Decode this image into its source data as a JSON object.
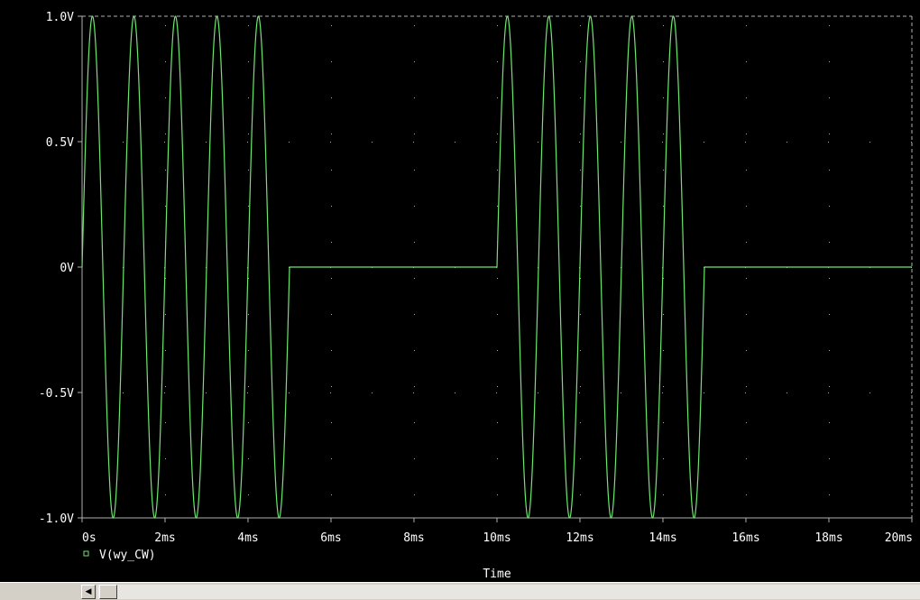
{
  "colors": {
    "background": "#000000",
    "trace": "#6ee66e",
    "grid": "#b0b0b0",
    "text": "#ffffff"
  },
  "chart_data": {
    "type": "line",
    "xlabel": "Time",
    "ylabel": "",
    "xlim": [
      0,
      20
    ],
    "ylim": [
      -1.0,
      1.0
    ],
    "x_unit": "ms",
    "x_ticks": [
      0,
      2,
      4,
      6,
      8,
      10,
      12,
      14,
      16,
      18,
      20
    ],
    "x_tick_labels": [
      "0s",
      "2ms",
      "4ms",
      "6ms",
      "8ms",
      "10ms",
      "12ms",
      "14ms",
      "16ms",
      "18ms",
      "20ms"
    ],
    "y_ticks": [
      1.0,
      0.5,
      0,
      -0.5,
      -1.0
    ],
    "y_tick_labels": [
      "1.0V",
      "0.5V",
      "0V",
      "-0.5V",
      "-1.0V"
    ],
    "grid": true,
    "legend_position": "bottom-left",
    "series": [
      {
        "name": "V(wy_CW)",
        "signal": "burst sine, amplitude 1.0V, 1kHz",
        "bursts": [
          {
            "start": 0,
            "end": 5,
            "amplitude": 1.0,
            "frequency_khz": 1.0
          },
          {
            "start": 10,
            "end": 15,
            "amplitude": 1.0,
            "frequency_khz": 1.0
          }
        ]
      }
    ]
  },
  "scrollbar": {
    "left_arrow": "◀",
    "right_arrow": "▶"
  }
}
